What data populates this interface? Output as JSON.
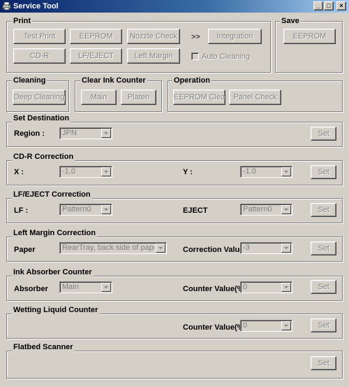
{
  "window": {
    "title": "Service Tool",
    "icon": "printer-app-icon",
    "controls": [
      "minimize",
      "maximize",
      "close"
    ]
  },
  "print": {
    "title": "Print",
    "test_print": "Test Print",
    "eeprom": "EEPROM",
    "nozzle_check": "Nozzle Check",
    "arrow": ">>",
    "integration": "Integration",
    "cdr": "CD-R",
    "lf_eject": "LF/EJECT",
    "left_margin": "Left Margin",
    "auto_cleaning": "Auto Cleaning"
  },
  "save": {
    "title": "Save",
    "eeprom": "EEPROM"
  },
  "cleaning": {
    "title": "Cleaning",
    "deep_cleaning": "Deep Cleaning"
  },
  "clear_ink_counter": {
    "title": "Clear Ink Counter",
    "main": "Main",
    "platen": "Platen"
  },
  "operation": {
    "title": "Operation",
    "eeprom_clear": "EEPROM Clear",
    "panel_check": "Panel Check"
  },
  "set_destination": {
    "title": "Set Destination",
    "region_label": "Region :",
    "region_value": "JPN",
    "set": "Set"
  },
  "cdr_correction": {
    "title": "CD-R Correction",
    "x_label": "X :",
    "x_value": "-1.0",
    "y_label": "Y :",
    "y_value": "-1.0",
    "set": "Set"
  },
  "lf_eject_correction": {
    "title": "LF/EJECT Correction",
    "lf_label": "LF :",
    "lf_value": "Pattern0",
    "eject_label": "EJECT",
    "eject_value": "Pattern0",
    "set": "Set"
  },
  "left_margin_correction": {
    "title": "Left Margin Correction",
    "paper_label": "Paper",
    "paper_value": "RearTray, back side of paper",
    "correction_label": "Correction Value",
    "correction_value": "-3",
    "set": "Set"
  },
  "ink_absorber_counter": {
    "title": "Ink Absorber Counter",
    "absorber_label": "Absorber",
    "absorber_value": "Main",
    "counter_label": "Counter Value(%)",
    "counter_value": "0",
    "set": "Set"
  },
  "wetting_liquid_counter": {
    "title": "Wetting Liquid Counter",
    "counter_label": "Counter Value(%)",
    "counter_value": "0",
    "set": "Set"
  },
  "flatbed_scanner": {
    "title": "Flatbed Scanner",
    "set": "Set"
  }
}
